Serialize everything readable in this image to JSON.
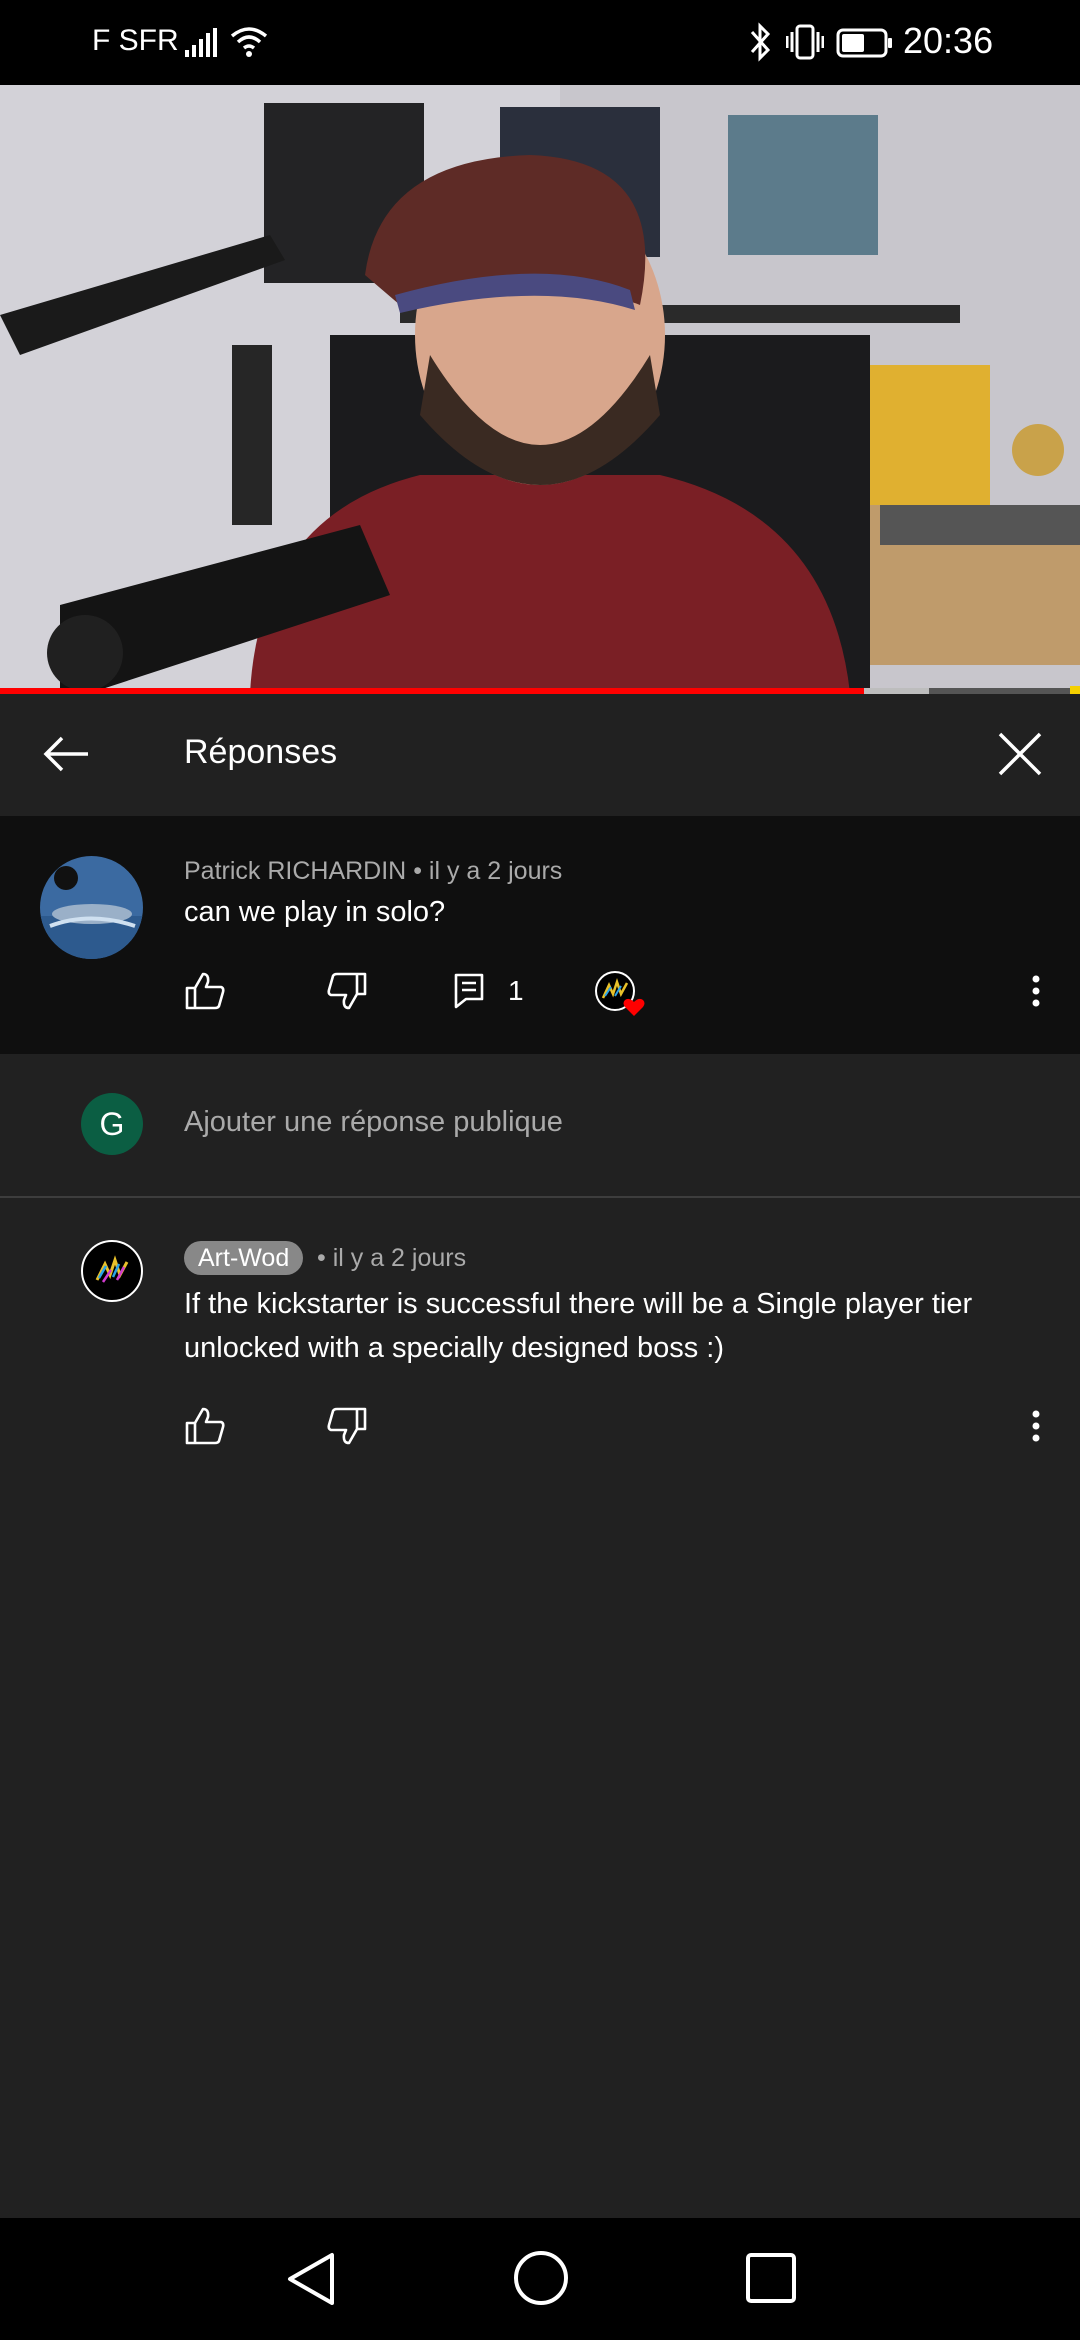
{
  "status_bar": {
    "carrier": "F SFR",
    "time": "20:36",
    "icons": [
      "signal-icon",
      "wifi-icon",
      "bluetooth-icon",
      "vibrate-icon",
      "battery-icon"
    ]
  },
  "video": {
    "progress_played": 0.8,
    "progress_buffered": 0.86
  },
  "header": {
    "title": "Réponses",
    "back_icon": "arrow-left-icon",
    "close_icon": "close-icon"
  },
  "parent_comment": {
    "author": "Patrick RICHARDIN",
    "time": "il y a 2 jours",
    "text": "can we play in solo?",
    "reply_count": "1"
  },
  "reply_input": {
    "user_initial": "G",
    "placeholder": "Ajouter une réponse publique"
  },
  "reply": {
    "author": "Art-Wod",
    "time": "il y a 2 jours",
    "text": "If the kickstarter is successful there will be a Single player tier unlocked with a specially designed boss :)"
  },
  "colors": {
    "background": "#212121",
    "parent_background": "#0f0f0f",
    "progress": "#ff0000",
    "avatar_g": "#0b5e43",
    "heart": "#ff0000"
  }
}
